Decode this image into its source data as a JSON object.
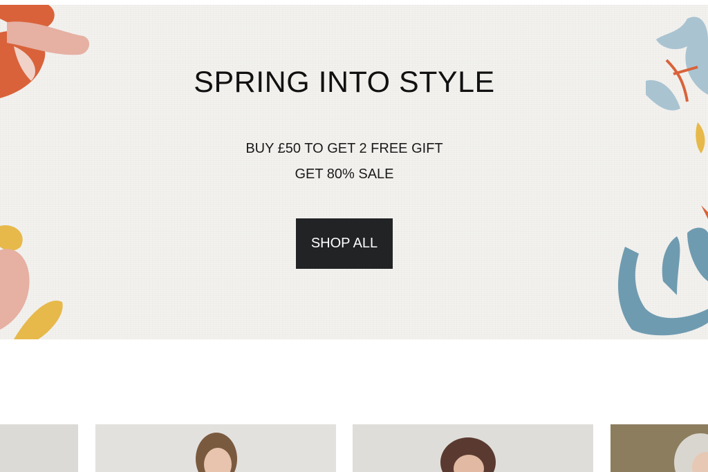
{
  "hero": {
    "title": "SPRING INTO STYLE",
    "line1": "BUY £50 TO GET 2 FREE GIFT",
    "line2": "GET 80% SALE",
    "cta_label": "SHOP ALL"
  },
  "colors": {
    "hero_bg": "#f3f2ef",
    "button_bg": "#222325",
    "accent_orange": "#d9623a",
    "accent_pink": "#e6b0a3",
    "accent_yellow": "#e7b94a",
    "accent_blue": "#6f9bb0"
  },
  "products": [
    {
      "icon": "product-photo"
    },
    {
      "icon": "product-photo-woman"
    },
    {
      "icon": "product-photo-woman"
    },
    {
      "icon": "product-photo-woman"
    }
  ]
}
